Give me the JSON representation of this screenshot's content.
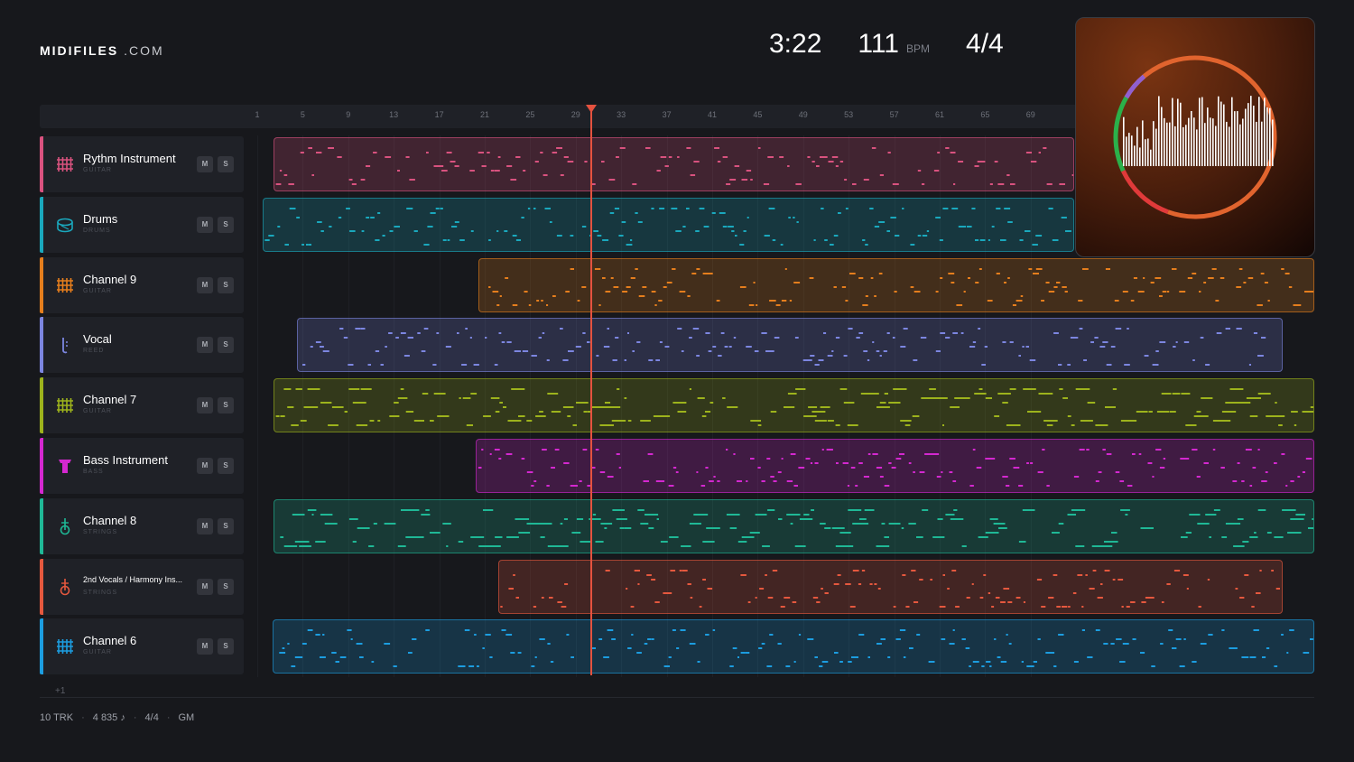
{
  "brand": {
    "bold": "MIDIFILES",
    "light": ".COM"
  },
  "transport": {
    "time": "3:22",
    "bpm": "111",
    "bpm_unit": "BPM",
    "signature": "4/4"
  },
  "ruler_ticks": [
    "1",
    "5",
    "9",
    "13",
    "17",
    "21",
    "25",
    "29",
    "33",
    "37",
    "41",
    "45",
    "49",
    "53",
    "57",
    "61",
    "65",
    "69"
  ],
  "tracks": [
    {
      "name": "Rythm Instrument",
      "type": "GUITAR",
      "color": "#d9527f",
      "icon": "guitar-grid-icon",
      "mute": "M",
      "solo": "S"
    },
    {
      "name": "Drums",
      "type": "DRUMS",
      "color": "#1aa8bd",
      "icon": "drum-icon",
      "mute": "M",
      "solo": "S"
    },
    {
      "name": "Channel 9",
      "type": "GUITAR",
      "color": "#e57e1d",
      "icon": "guitar-grid-icon",
      "mute": "M",
      "solo": "S"
    },
    {
      "name": "Vocal",
      "type": "REED",
      "color": "#7c86e0",
      "icon": "reed-icon",
      "mute": "M",
      "solo": "S"
    },
    {
      "name": "Channel 7",
      "type": "GUITAR",
      "color": "#9db31c",
      "icon": "guitar-grid-icon",
      "mute": "M",
      "solo": "S"
    },
    {
      "name": "Bass Instrument",
      "type": "BASS",
      "color": "#d428d0",
      "icon": "bass-icon",
      "mute": "M",
      "solo": "S"
    },
    {
      "name": "Channel 8",
      "type": "STRINGS",
      "color": "#1fb896",
      "icon": "strings-icon",
      "mute": "M",
      "solo": "S"
    },
    {
      "name": "2nd Vocals / Harmony Ins...",
      "type": "STRINGS",
      "color": "#e5583e",
      "icon": "strings-icon",
      "mute": "M",
      "solo": "S"
    },
    {
      "name": "Channel 6",
      "type": "GUITAR",
      "color": "#1c9de0",
      "icon": "guitar-grid-icon",
      "mute": "M",
      "solo": "S"
    }
  ],
  "more_tracks": "+1",
  "footer": {
    "tracks": "10 TRK",
    "notes": "4 835 ♪",
    "signature": "4/4",
    "standard": "GM"
  },
  "album_art": {
    "ring_colors": [
      "#e1642e",
      "#2bb04a",
      "#9060d0",
      "#e03a3a"
    ]
  }
}
